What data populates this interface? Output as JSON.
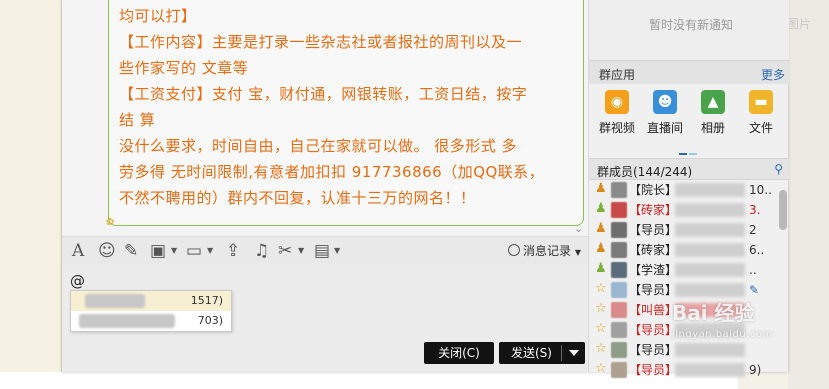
{
  "background": {
    "right_text": "无图片"
  },
  "chat": {
    "lines": [
      "均可以打】",
      "【工作内容】主要是打录一些杂志社或者报社的周刊以及一",
      "些作家写的 文章等",
      "【工资支付】支付 宝，财付通，网银转账，工资日结，按字",
      "结 算",
      " 没什么要求，时间自由，自己在家就可以做。 很多形式 多",
      "劳多得 无时间限制,有意者加扣扣 917736866（加QQ联系，",
      "不然不聘用的）群内不回复，认准十三万的网名！！"
    ]
  },
  "toolbar": {
    "history_label": "消息记录"
  },
  "input": {
    "text": "@",
    "suggestions": [
      {
        "id_suffix": "1517)"
      },
      {
        "id_suffix": "703)"
      }
    ]
  },
  "buttons": {
    "close_label": "关闭(C)",
    "send_label": "发送(S)"
  },
  "notice": {
    "text": "暂时没有新通知"
  },
  "apps": {
    "title": "群应用",
    "more": "更多",
    "items": [
      {
        "label": "群视频",
        "icon": "group-video-icon",
        "color": "#f5a01a"
      },
      {
        "label": "直播间",
        "icon": "live-room-icon",
        "color": "#3b8fd9"
      },
      {
        "label": "相册",
        "icon": "album-icon",
        "color": "#4aa34a"
      },
      {
        "label": "文件",
        "icon": "file-icon",
        "color": "#f0b52a"
      }
    ]
  },
  "members": {
    "title": "群成员(144/244)",
    "list": [
      {
        "tag": "【院长】",
        "color": "#222222",
        "num": "10..",
        "icon": "owner-icon",
        "avatar": "#8a8a8a"
      },
      {
        "tag": "【砖家】",
        "color": "#cc1f1f",
        "num": "3.",
        "icon": "admin-icon",
        "avatar": "#c94a4a"
      },
      {
        "tag": "【导员】",
        "color": "#222222",
        "num": "2",
        "icon": "admin-icon",
        "avatar": "#6e6e6e"
      },
      {
        "tag": "【砖家】",
        "color": "#222222",
        "num": "6..",
        "icon": "admin-icon",
        "avatar": "#7a7a7a"
      },
      {
        "tag": "【学渣】",
        "color": "#222222",
        "num": "..",
        "icon": "admin-icon",
        "avatar": "#5c6b7a"
      },
      {
        "tag": "【导员】",
        "color": "#222222",
        "num": "",
        "icon": "star-icon",
        "avatar": "#9ab7cf"
      },
      {
        "tag": "【叫兽】",
        "color": "#cc1f1f",
        "num": "",
        "icon": "star-icon",
        "avatar": "#d98b8b"
      },
      {
        "tag": "【导员】",
        "color": "#cc1f1f",
        "num": "",
        "icon": "star-icon",
        "avatar": "#a0a0a0"
      },
      {
        "tag": "【导员】",
        "color": "#222222",
        "num": "",
        "icon": "star-icon",
        "avatar": "#8f9c87"
      },
      {
        "tag": "【导员】",
        "color": "#cc1f1f",
        "num": "9)",
        "icon": "star-icon",
        "avatar": "#b0a090"
      }
    ]
  },
  "watermark": {
    "brand": "Bai 经验",
    "url": "jingyan.baidu.com"
  }
}
